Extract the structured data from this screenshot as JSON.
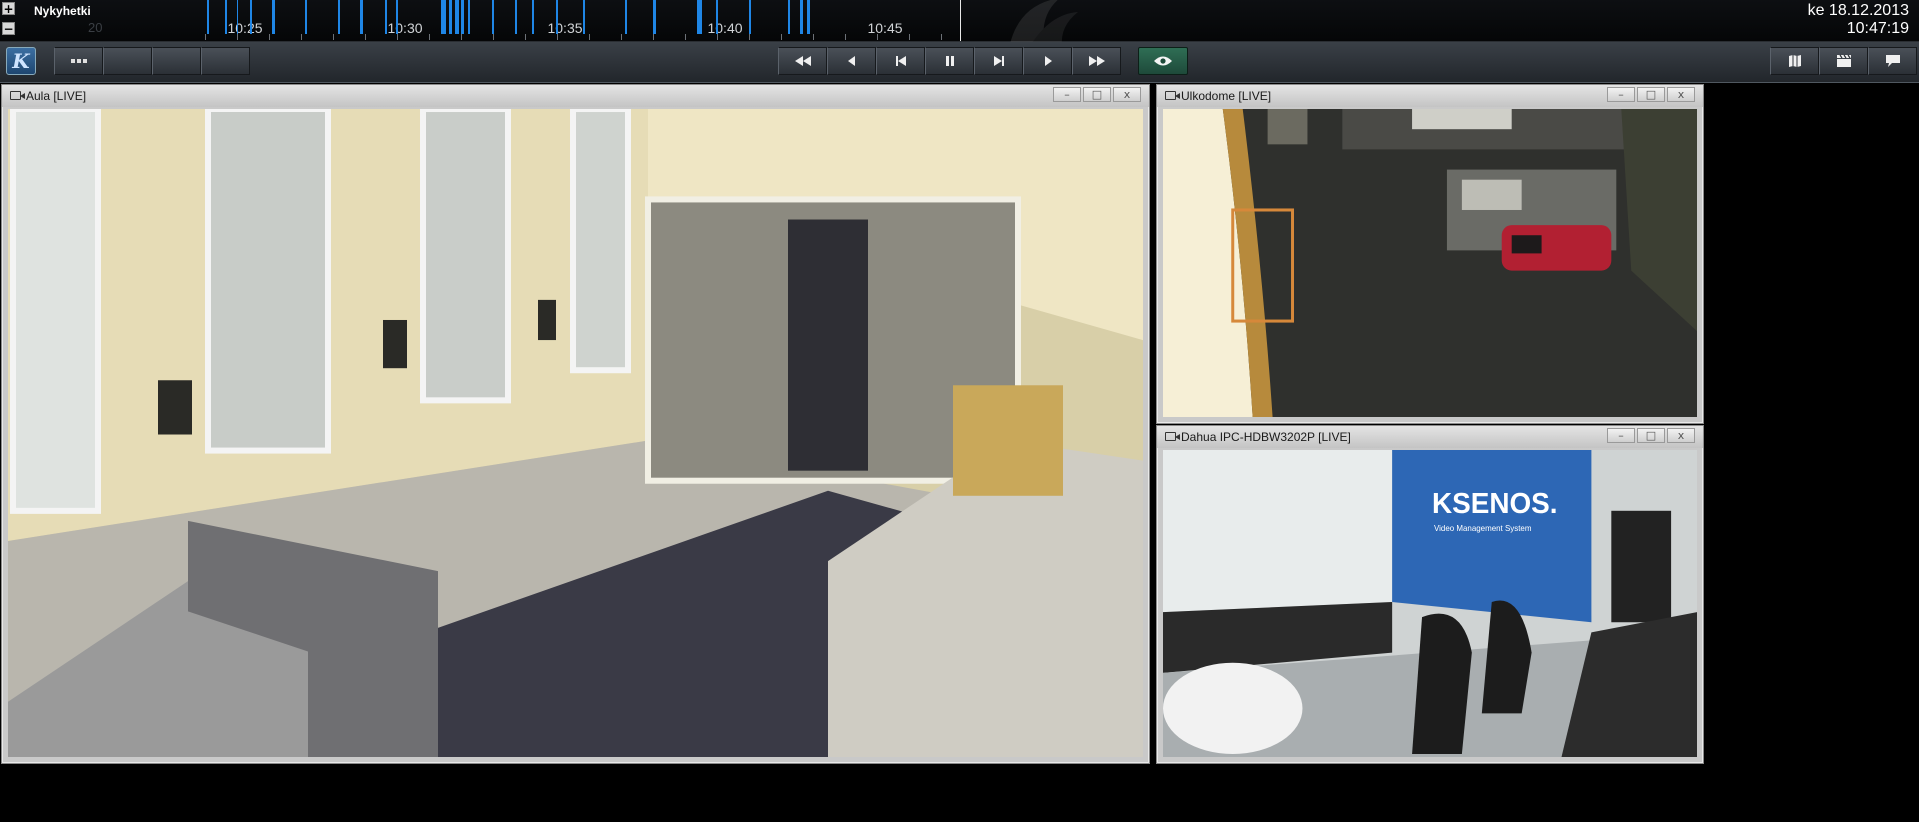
{
  "timeline": {
    "title": "Nykyhetki",
    "faded_label": "20",
    "ticks": [
      "10:25",
      "10:30",
      "10:35",
      "10:40",
      "10:45"
    ],
    "date": "ke 18.12.2013",
    "time": "10:47:19",
    "zoom_in": "+",
    "zoom_out": "−"
  },
  "toolbar": {
    "logo": "K",
    "playback_icons": [
      "fast-rewind-icon",
      "step-back-icon",
      "skip-start-icon",
      "pause-icon",
      "skip-end-icon",
      "play-icon",
      "fast-forward-icon"
    ],
    "right_icons": [
      "map-icon",
      "clapperboard-icon",
      "chat-icon"
    ],
    "accent_color": "#1f86e6",
    "eye_color": "#2f6e55"
  },
  "cameras": [
    {
      "title": "Aula [LIVE]",
      "feed": "lobby-camera-feed"
    },
    {
      "title": "Ulkodome [LIVE]",
      "feed": "outdoor-camera-feed"
    },
    {
      "title": "Dahua IPC-HDBW3202P [LIVE]",
      "feed": "booth-camera-feed"
    }
  ],
  "window_controls": {
    "minimize": "–",
    "maximize": "□",
    "close": "x"
  },
  "scene_text": {
    "booth_brand": "KSENOS.",
    "booth_subtitle": "Video Management System"
  }
}
